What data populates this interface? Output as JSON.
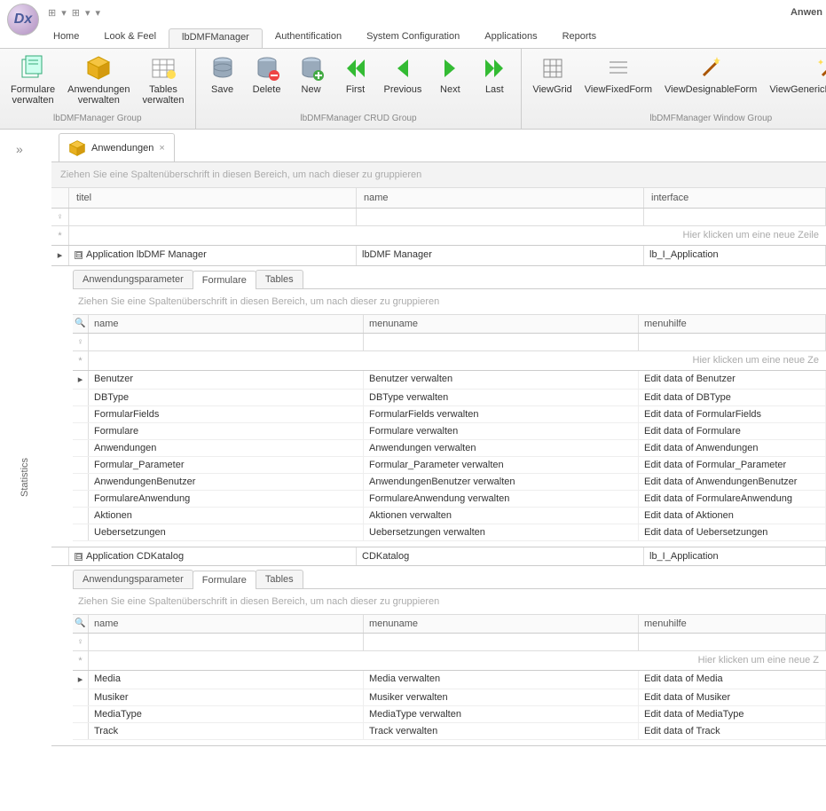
{
  "app_title": "Anwen",
  "logo_text": "Dx",
  "qat": {
    "i1": "⊞",
    "i2": "▾",
    "i3": "⊞",
    "i4": "▾",
    "i5": "▾"
  },
  "ribbon_tabs": [
    "Home",
    "Look & Feel",
    "lbDMFManager",
    "Authentification",
    "System Configuration",
    "Applications",
    "Reports"
  ],
  "active_ribbon_tab": 2,
  "ribbon_groups": [
    {
      "label": "lbDMFManager Group",
      "items": [
        {
          "name": "formulare-verwalten",
          "label": "Formulare\nverwalten",
          "icon": "forms"
        },
        {
          "name": "anwendungen-verwalten",
          "label": "Anwendungen\nverwalten",
          "icon": "box"
        },
        {
          "name": "tables-verwalten",
          "label": "Tables\nverwalten",
          "icon": "table"
        }
      ]
    },
    {
      "label": "lbDMFManager CRUD Group",
      "items": [
        {
          "name": "save",
          "label": "Save",
          "icon": "db"
        },
        {
          "name": "delete",
          "label": "Delete",
          "icon": "db-del"
        },
        {
          "name": "new",
          "label": "New",
          "icon": "db-add"
        },
        {
          "name": "first",
          "label": "First",
          "icon": "first"
        },
        {
          "name": "previous",
          "label": "Previous",
          "icon": "prev"
        },
        {
          "name": "next",
          "label": "Next",
          "icon": "next"
        },
        {
          "name": "last",
          "label": "Last",
          "icon": "last"
        }
      ]
    },
    {
      "label": "lbDMFManager Window Group",
      "items": [
        {
          "name": "viewgrid",
          "label": "ViewGrid",
          "icon": "grid"
        },
        {
          "name": "viewfixedform",
          "label": "ViewFixedForm",
          "icon": "lines"
        },
        {
          "name": "viewdesignableform",
          "label": "ViewDesignableForm",
          "icon": "wand"
        },
        {
          "name": "viewgenericdatalayout",
          "label": "ViewGenericDataLayoutFor",
          "icon": "wand2"
        }
      ]
    }
  ],
  "sidebar": {
    "toggle": "»",
    "stats": "Statistics"
  },
  "doc_tab": {
    "label": "Anwendungen",
    "close": "×"
  },
  "main_grid": {
    "group_hint": "Ziehen Sie eine Spaltenüberschrift in diesen Bereich, um nach dieser zu gruppieren",
    "columns": [
      "titel",
      "name",
      "interface"
    ],
    "filter_glyph": "♀",
    "newrow_glyph": "*",
    "newrow_text": "Hier klicken um eine neue Zeile",
    "row_indicator": "▸"
  },
  "applications": [
    {
      "titel": "Application lbDMF Manager",
      "name": "lbDMF Manager",
      "interface": "lb_I_Application",
      "detail_tabs": [
        "Anwendungsparameter",
        "Formulare",
        "Tables"
      ],
      "active_detail": 1,
      "sub_group_hint": "Ziehen Sie eine Spaltenüberschrift in diesen Bereich, um nach dieser zu gruppieren",
      "sub_columns": [
        "name",
        "menuname",
        "menuhilfe"
      ],
      "sub_search_glyph": "🔍",
      "sub_filter_glyph": "♀",
      "sub_new_glyph": "*",
      "sub_new_text": "Hier klicken um eine neue Ze",
      "rows": [
        {
          "name": "Benutzer",
          "menuname": "Benutzer verwalten",
          "menuhilfe": "Edit data of Benutzer",
          "ind": "▸"
        },
        {
          "name": "DBType",
          "menuname": "DBType verwalten",
          "menuhilfe": "Edit data of DBType"
        },
        {
          "name": "FormularFields",
          "menuname": "FormularFields verwalten",
          "menuhilfe": "Edit data of FormularFields"
        },
        {
          "name": "Formulare",
          "menuname": "Formulare verwalten",
          "menuhilfe": "Edit data of Formulare"
        },
        {
          "name": "Anwendungen",
          "menuname": "Anwendungen verwalten",
          "menuhilfe": "Edit data of Anwendungen"
        },
        {
          "name": "Formular_Parameter",
          "menuname": "Formular_Parameter verwalten",
          "menuhilfe": "Edit data of Formular_Parameter"
        },
        {
          "name": "AnwendungenBenutzer",
          "menuname": "AnwendungenBenutzer verwalten",
          "menuhilfe": "Edit data of AnwendungenBenutzer"
        },
        {
          "name": "FormulareAnwendung",
          "menuname": "FormulareAnwendung verwalten",
          "menuhilfe": "Edit data of FormulareAnwendung"
        },
        {
          "name": "Aktionen",
          "menuname": "Aktionen verwalten",
          "menuhilfe": "Edit data of Aktionen"
        },
        {
          "name": "Uebersetzungen",
          "menuname": "Uebersetzungen verwalten",
          "menuhilfe": "Edit data of Uebersetzungen"
        }
      ]
    },
    {
      "titel": "Application CDKatalog",
      "name": "CDKatalog",
      "interface": "lb_I_Application",
      "detail_tabs": [
        "Anwendungsparameter",
        "Formulare",
        "Tables"
      ],
      "active_detail": 1,
      "sub_group_hint": "Ziehen Sie eine Spaltenüberschrift in diesen Bereich, um nach dieser zu gruppieren",
      "sub_columns": [
        "name",
        "menuname",
        "menuhilfe"
      ],
      "sub_search_glyph": "🔍",
      "sub_filter_glyph": "♀",
      "sub_new_glyph": "*",
      "sub_new_text": "Hier klicken um eine neue Z",
      "rows": [
        {
          "name": "Media",
          "menuname": "Media verwalten",
          "menuhilfe": "Edit data of Media",
          "ind": "▸"
        },
        {
          "name": "Musiker",
          "menuname": "Musiker verwalten",
          "menuhilfe": "Edit data of Musiker"
        },
        {
          "name": "MediaType",
          "menuname": "MediaType verwalten",
          "menuhilfe": "Edit data of MediaType"
        },
        {
          "name": "Track",
          "menuname": "Track verwalten",
          "menuhilfe": "Edit data of Track"
        }
      ]
    }
  ]
}
